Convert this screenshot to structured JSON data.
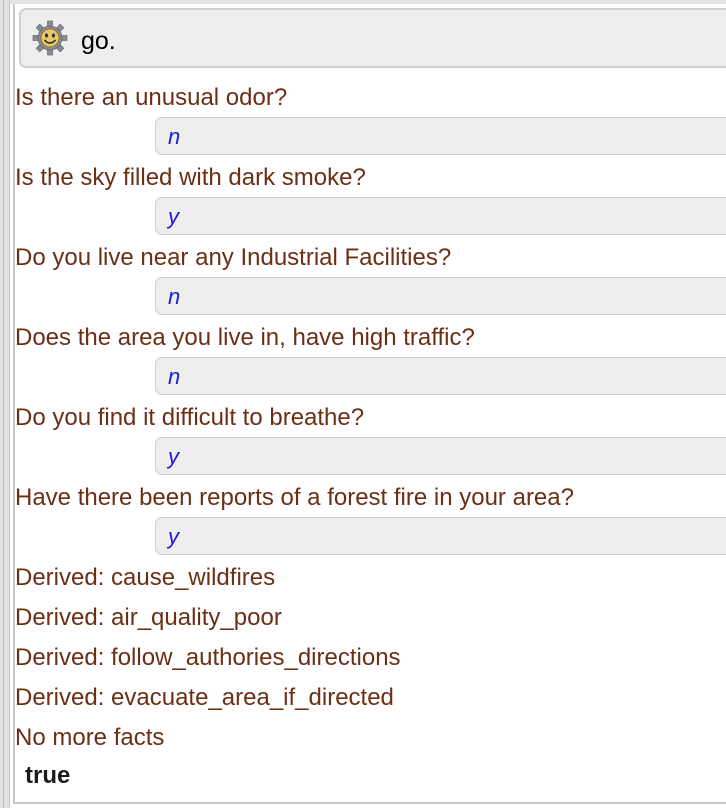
{
  "query": {
    "text": "go.",
    "icon": "swi-prolog-gear-icon"
  },
  "dialog": [
    {
      "question": "Is there an unusual odor?",
      "answer": "n"
    },
    {
      "question": "Is the sky filled with dark smoke?",
      "answer": "y"
    },
    {
      "question": "Do you live near any Industrial Facilities?",
      "answer": "n"
    },
    {
      "question": "Does the area you live in, have high traffic?",
      "answer": "n"
    },
    {
      "question": "Do you find it difficult to breathe?",
      "answer": "y"
    },
    {
      "question": "Have there been reports of a forest fire in your area?",
      "answer": "y"
    }
  ],
  "derived": [
    "Derived: cause_wildfires",
    "Derived: air_quality_poor",
    "Derived: follow_authories_directions",
    "Derived: evacuate_area_if_directed"
  ],
  "final_message": "No more facts",
  "result": "true",
  "colors": {
    "text": "#6b2f16",
    "answer": "#1a1adf",
    "box_bg": "#eeeeee"
  }
}
